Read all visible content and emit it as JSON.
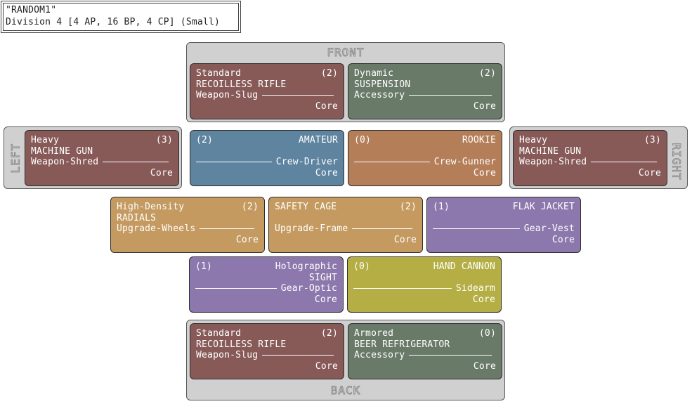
{
  "header": {
    "name": "\"RANDOM1\"",
    "summary": "Division 4 [4 AP, 16 BP, 4 CP] (Small)"
  },
  "panels": {
    "front": "FRONT",
    "back": "BACK",
    "left": "LEFT",
    "right": "RIGHT"
  },
  "colors": {
    "weapon": "#875a58",
    "accessory": "#697a69",
    "crew_driver": "#5f84a0",
    "crew_gunner": "#b47e58",
    "upgrade": "#c49a60",
    "gear": "#8c78ac",
    "sidearm": "#b4ae44",
    "panel": "#d0d0d0"
  },
  "cards": {
    "front_weapon": {
      "line1": "Standard",
      "cost": "(2)",
      "line2": "RECOILLESS RIFLE",
      "type": "Weapon-Slug",
      "tag": "Core"
    },
    "front_accessory": {
      "line1": "Dynamic",
      "cost": "(2)",
      "line2": "SUSPENSION",
      "type": "Accessory",
      "tag": "Core"
    },
    "left_weapon": {
      "line1": "Heavy",
      "cost": "(3)",
      "line2": "MACHINE GUN",
      "type": "Weapon-Shred",
      "tag": "Core"
    },
    "driver": {
      "cost": "(2)",
      "name": "AMATEUR",
      "type": "Crew-Driver",
      "tag": "Core"
    },
    "gunner": {
      "cost": "(0)",
      "name": "ROOKIE",
      "type": "Crew-Gunner",
      "tag": "Core"
    },
    "right_weapon": {
      "line1": "Heavy",
      "cost": "(3)",
      "line2": "MACHINE GUN",
      "type": "Weapon-Shred",
      "tag": "Core"
    },
    "radials": {
      "line1": "High-Density",
      "cost": "(2)",
      "line2": "RADIALS",
      "type": "Upgrade-Wheels",
      "tag": "Core"
    },
    "cage": {
      "line1": "SAFETY CAGE",
      "cost": "(2)",
      "type": "Upgrade-Frame",
      "tag": "Core"
    },
    "flak": {
      "cost": "(1)",
      "name": "FLAK JACKET",
      "type": "Gear-Vest",
      "tag": "Core"
    },
    "sight": {
      "cost": "(1)",
      "name1": "Holographic",
      "name2": "SIGHT",
      "type": "Gear-Optic",
      "tag": "Core"
    },
    "cannon": {
      "cost": "(0)",
      "name": "HAND CANNON",
      "type": "Sidearm",
      "tag": "Core"
    },
    "back_weapon": {
      "line1": "Standard",
      "cost": "(2)",
      "line2": "RECOILLESS RIFLE",
      "type": "Weapon-Slug",
      "tag": "Core"
    },
    "back_accessory": {
      "line1": "Armored",
      "cost": "(0)",
      "line2": "BEER REFRIGERATOR",
      "type": "Accessory",
      "tag": "Core"
    }
  }
}
